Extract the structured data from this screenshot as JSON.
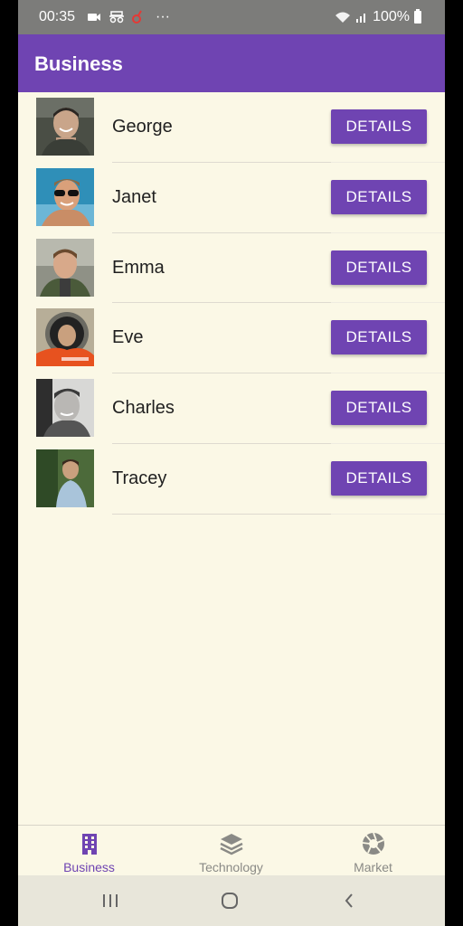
{
  "status_bar": {
    "time": "00:35",
    "dots": "···",
    "battery_text": "100%"
  },
  "app_bar": {
    "title": "Business",
    "color": "#6F44B2"
  },
  "list": {
    "button_label": "DETAILS",
    "items": [
      {
        "name": "George"
      },
      {
        "name": "Janet"
      },
      {
        "name": "Emma"
      },
      {
        "name": "Eve"
      },
      {
        "name": "Charles"
      },
      {
        "name": "Tracey"
      }
    ]
  },
  "bottom_nav": {
    "items": [
      {
        "label": "Business",
        "icon": "building-icon",
        "active": true
      },
      {
        "label": "Technology",
        "icon": "layers-icon",
        "active": false
      },
      {
        "label": "Market",
        "icon": "aperture-icon",
        "active": false
      }
    ]
  },
  "colors": {
    "accent": "#6F44B2",
    "background": "#FBF8E6",
    "inactive": "#8A8A86"
  }
}
